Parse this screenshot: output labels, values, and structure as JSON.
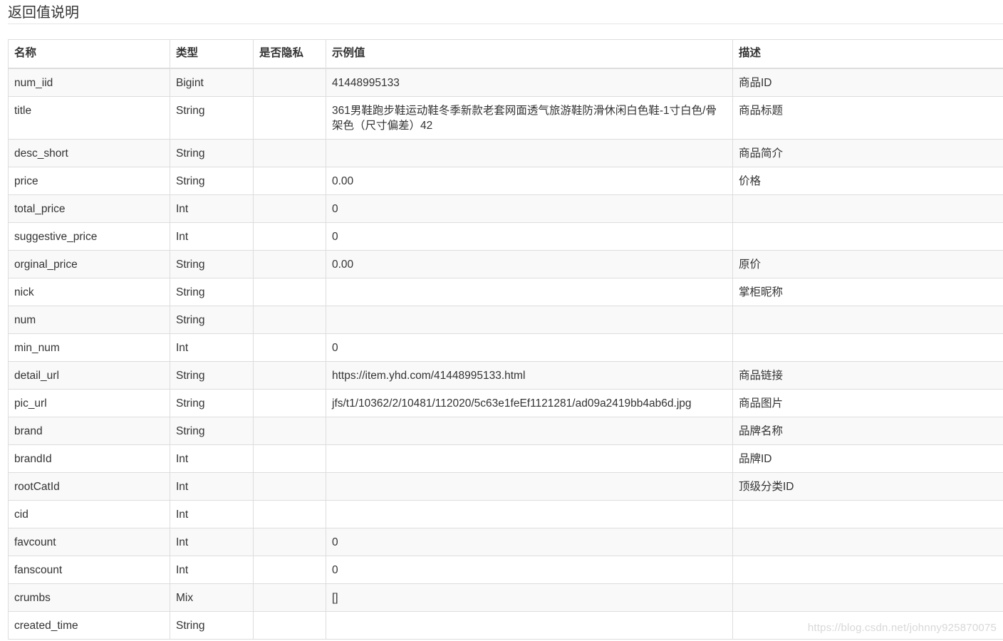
{
  "section_title": "返回值说明",
  "table": {
    "headers": [
      "名称",
      "类型",
      "是否隐私",
      "示例值",
      "描述"
    ],
    "rows": [
      {
        "name": "num_iid",
        "type": "Bigint",
        "privacy": "",
        "example": "41448995133",
        "desc": "商品ID"
      },
      {
        "name": "title",
        "type": "String",
        "privacy": "",
        "example": "361男鞋跑步鞋运动鞋冬季新款老套网面透气旅游鞋防滑休闲白色鞋-1寸白色/骨架色（尺寸偏差）42",
        "desc": "商品标题"
      },
      {
        "name": "desc_short",
        "type": "String",
        "privacy": "",
        "example": "",
        "desc": "商品简介"
      },
      {
        "name": "price",
        "type": "String",
        "privacy": "",
        "example": "0.00",
        "desc": "价格"
      },
      {
        "name": "total_price",
        "type": "Int",
        "privacy": "",
        "example": "0",
        "desc": ""
      },
      {
        "name": "suggestive_price",
        "type": "Int",
        "privacy": "",
        "example": "0",
        "desc": ""
      },
      {
        "name": "orginal_price",
        "type": "String",
        "privacy": "",
        "example": "0.00",
        "desc": "原价"
      },
      {
        "name": "nick",
        "type": "String",
        "privacy": "",
        "example": "",
        "desc": "掌柜昵称"
      },
      {
        "name": "num",
        "type": "String",
        "privacy": "",
        "example": "",
        "desc": ""
      },
      {
        "name": "min_num",
        "type": "Int",
        "privacy": "",
        "example": "0",
        "desc": ""
      },
      {
        "name": "detail_url",
        "type": "String",
        "privacy": "",
        "example": "https://item.yhd.com/41448995133.html",
        "desc": "商品链接"
      },
      {
        "name": "pic_url",
        "type": "String",
        "privacy": "",
        "example": "jfs/t1/10362/2/10481/112020/5c63e1feEf1121281/ad09a2419bb4ab6d.jpg",
        "desc": "商品图片"
      },
      {
        "name": "brand",
        "type": "String",
        "privacy": "",
        "example": "",
        "desc": "品牌名称"
      },
      {
        "name": "brandId",
        "type": "Int",
        "privacy": "",
        "example": "",
        "desc": "品牌ID"
      },
      {
        "name": "rootCatId",
        "type": "Int",
        "privacy": "",
        "example": "",
        "desc": "顶级分类ID"
      },
      {
        "name": "cid",
        "type": "Int",
        "privacy": "",
        "example": "",
        "desc": ""
      },
      {
        "name": "favcount",
        "type": "Int",
        "privacy": "",
        "example": "0",
        "desc": ""
      },
      {
        "name": "fanscount",
        "type": "Int",
        "privacy": "",
        "example": "0",
        "desc": ""
      },
      {
        "name": "crumbs",
        "type": "Mix",
        "privacy": "",
        "example": "[]",
        "desc": ""
      },
      {
        "name": "created_time",
        "type": "String",
        "privacy": "",
        "example": "",
        "desc": ""
      }
    ]
  },
  "watermark": "https://blog.csdn.net/johnny925870075"
}
